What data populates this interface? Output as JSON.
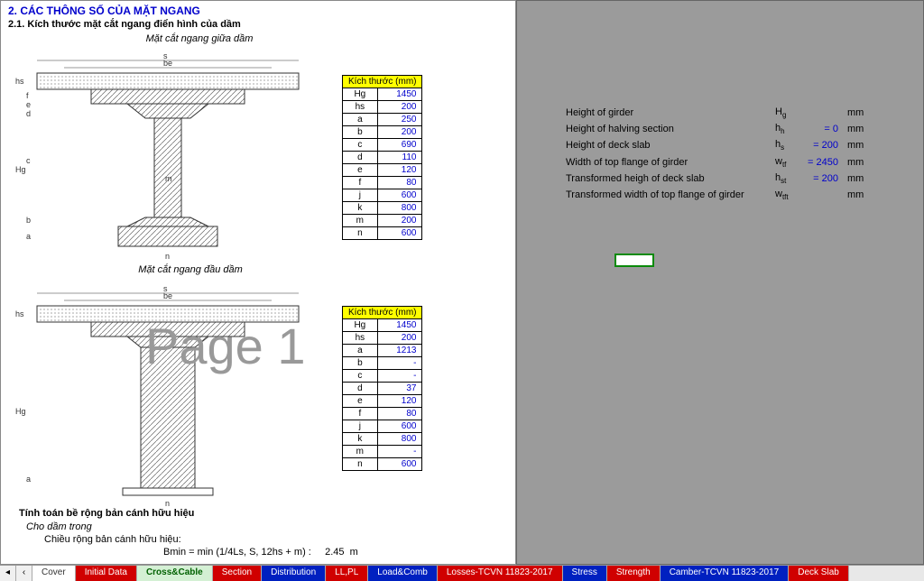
{
  "headings": {
    "h1": "2. CÁC THÔNG SỐ CỦA MẶT NGANG",
    "h2": "2.1. Kích thước mặt cắt ngang điển hình của dầm",
    "cap1": "Mặt cắt ngang giữa dầm",
    "cap2": "Mặt cắt ngang đầu dầm"
  },
  "table_header": "Kích thước (mm)",
  "table1": [
    {
      "k": "Hg",
      "v": "1450"
    },
    {
      "k": "hs",
      "v": "200"
    },
    {
      "k": "a",
      "v": "250"
    },
    {
      "k": "b",
      "v": "200"
    },
    {
      "k": "c",
      "v": "690"
    },
    {
      "k": "d",
      "v": "110"
    },
    {
      "k": "e",
      "v": "120"
    },
    {
      "k": "f",
      "v": "80"
    },
    {
      "k": "j",
      "v": "600"
    },
    {
      "k": "k",
      "v": "800"
    },
    {
      "k": "m",
      "v": "200"
    },
    {
      "k": "n",
      "v": "600"
    }
  ],
  "table2": [
    {
      "k": "Hg",
      "v": "1450"
    },
    {
      "k": "hs",
      "v": "200"
    },
    {
      "k": "a",
      "v": "1213"
    },
    {
      "k": "b",
      "v": "-"
    },
    {
      "k": "c",
      "v": "-"
    },
    {
      "k": "d",
      "v": "37"
    },
    {
      "k": "e",
      "v": "120"
    },
    {
      "k": "f",
      "v": "80"
    },
    {
      "k": "j",
      "v": "600"
    },
    {
      "k": "k",
      "v": "800"
    },
    {
      "k": "m",
      "v": "-"
    },
    {
      "k": "n",
      "v": "600"
    }
  ],
  "watermark": "Page 1",
  "calc": {
    "title": "Tính toán bề rộng bản cánh hữu hiệu",
    "sub": "Cho dầm trong",
    "line1_label": "Chiều rộng bản cánh hữu hiệu:",
    "formula_label": "Bmin = min (1/4Ls, S, 12hs + m) :",
    "formula_val": "2.45",
    "formula_unit": "m"
  },
  "right_rows": [
    {
      "label": "Height of girder",
      "sym": "H",
      "sub": "g",
      "eq": "",
      "val": "",
      "unit": "mm"
    },
    {
      "label": "Height of halving section",
      "sym": "h",
      "sub": "h",
      "eq": "=",
      "val": "0",
      "unit": "mm"
    },
    {
      "label": "Height of deck slab",
      "sym": "h",
      "sub": "s",
      "eq": "=",
      "val": "200",
      "unit": "mm"
    },
    {
      "label": "Width of top flange of girder",
      "sym": "w",
      "sub": "tf",
      "eq": "=",
      "val": "2450",
      "unit": "mm"
    },
    {
      "label": "Transformed heigh of deck slab",
      "sym": "h",
      "sub": "st",
      "eq": "=",
      "val": "200",
      "unit": "mm"
    },
    {
      "label": "Transformed width of top flange of girder",
      "sym": "w",
      "sub": "tft",
      "eq": "",
      "val": "",
      "unit": "mm"
    }
  ],
  "tabs": [
    {
      "label": "Cover",
      "cls": "wht"
    },
    {
      "label": "Initial Data",
      "cls": "red"
    },
    {
      "label": "Cross&Cable",
      "cls": "active"
    },
    {
      "label": "Section",
      "cls": "red"
    },
    {
      "label": "Distribution",
      "cls": "blue"
    },
    {
      "label": "LL,PL",
      "cls": "red"
    },
    {
      "label": "Load&Comb",
      "cls": "blue"
    },
    {
      "label": "Losses-TCVN 11823-2017",
      "cls": "red"
    },
    {
      "label": "Stress",
      "cls": "blue"
    },
    {
      "label": "Strength",
      "cls": "red"
    },
    {
      "label": "Camber-TCVN 11823-2017",
      "cls": "blue"
    },
    {
      "label": "Deck Slab",
      "cls": "red"
    }
  ]
}
